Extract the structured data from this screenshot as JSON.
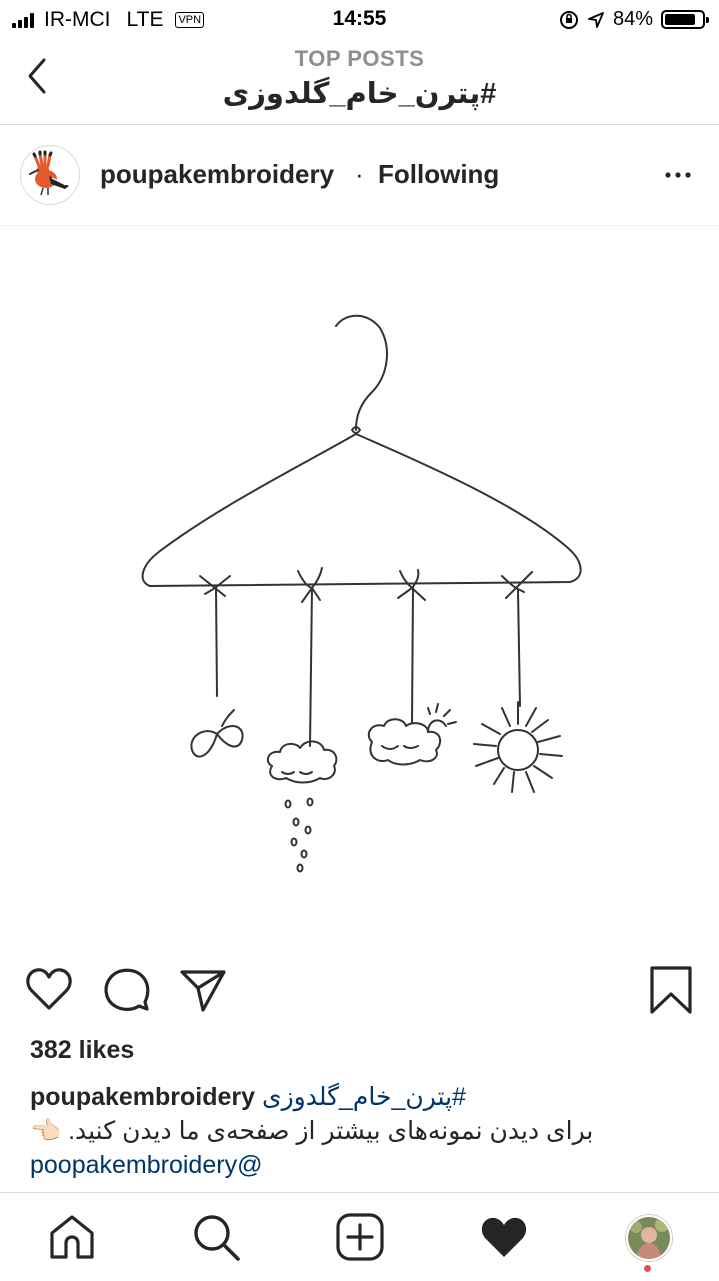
{
  "status_bar": {
    "carrier": "IR-MCI",
    "network": "LTE",
    "vpn": "VPN",
    "time": "14:55",
    "battery": "84%",
    "battery_level": 0.84
  },
  "header": {
    "subtitle": "TOP POSTS",
    "title": "#پترن_خام_گلدوزی"
  },
  "post": {
    "username": "poupakembroidery",
    "separator": "·",
    "follow_status": "Following",
    "likes": "382 likes",
    "caption": {
      "username": "poupakembroidery",
      "hashtag": "#پترن_خام_گلدوزی",
      "text": "برای دیدن نمونه‌های بیشتر از صفحه‌ی ما دیدن کنید. 👈🏻",
      "mention": "poopakembroidery@"
    }
  },
  "icons": {
    "back": "chevron-left-icon",
    "more": "more-options-icon",
    "like": "heart-outline-icon",
    "comment": "comment-icon",
    "share": "send-icon",
    "save": "bookmark-icon",
    "home": "home-icon",
    "search": "search-icon",
    "add": "add-post-icon",
    "activity": "heart-filled-icon",
    "profile": "profile-avatar"
  },
  "colors": {
    "link": "#003569",
    "notification": "#ed4956",
    "divider": "#dbdbdb"
  }
}
